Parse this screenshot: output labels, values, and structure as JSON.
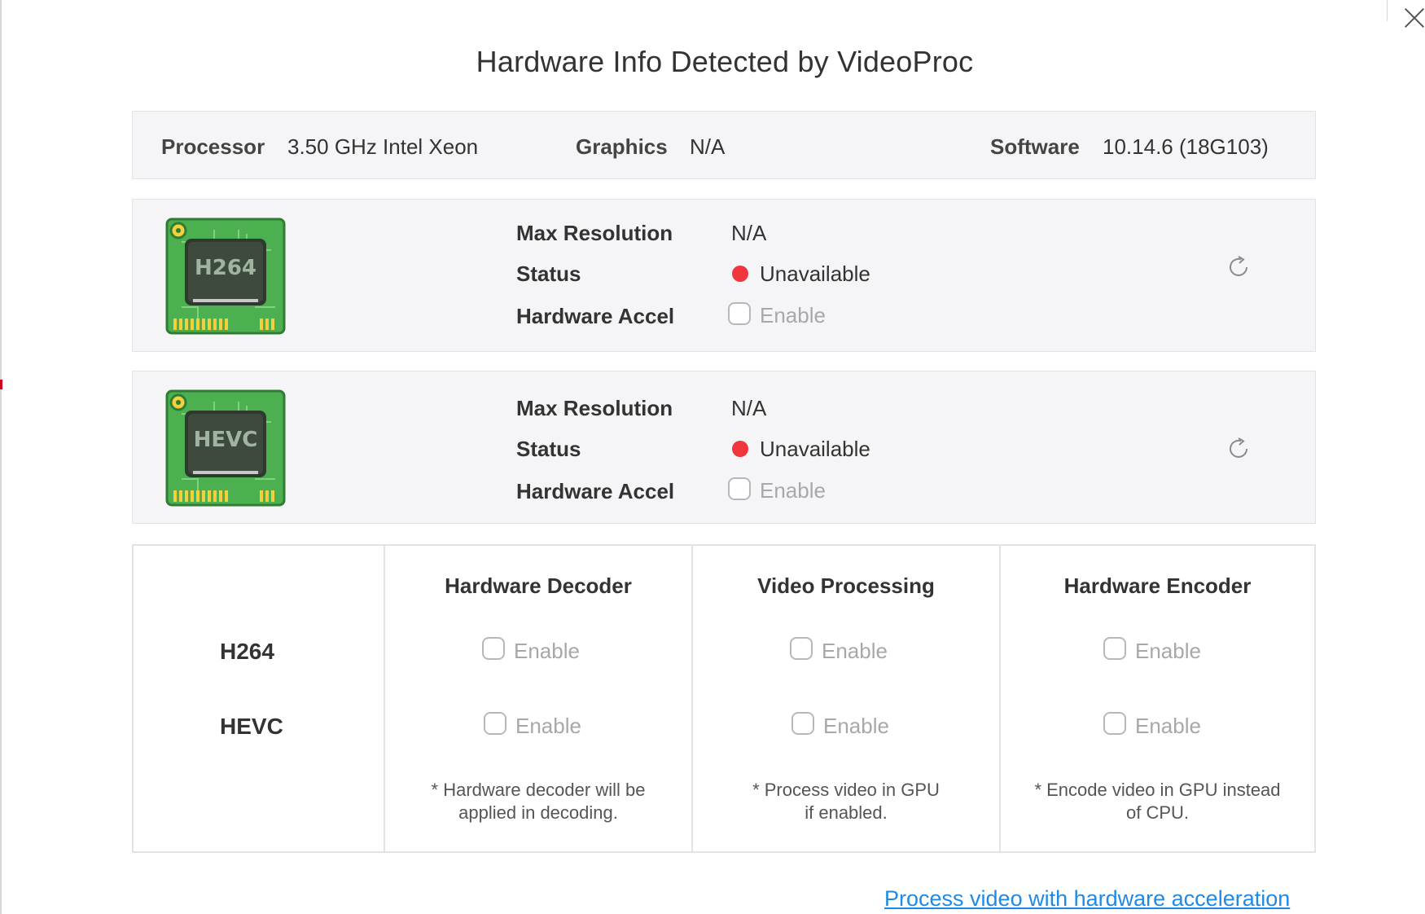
{
  "dialog": {
    "title": "Hardware Info Detected by VideoProc",
    "close_icon": "close-icon"
  },
  "system": {
    "processor_label": "Processor",
    "processor_value": "3.50 GHz Intel Xeon",
    "graphics_label": "Graphics",
    "graphics_value": "N/A",
    "software_label": "Software",
    "software_value": "10.14.6 (18G103)"
  },
  "codecs": [
    {
      "chip_label": "H264",
      "max_resolution_label": "Max Resolution",
      "max_resolution_value": "N/A",
      "status_label": "Status",
      "status_value": "Unavailable",
      "status_color": "#f0353d",
      "accel_label": "Hardware Accel",
      "accel_checkbox_label": "Enable",
      "refresh_icon": "refresh-icon"
    },
    {
      "chip_label": "HEVC",
      "max_resolution_label": "Max Resolution",
      "max_resolution_value": "N/A",
      "status_label": "Status",
      "status_value": "Unavailable",
      "status_color": "#f0353d",
      "accel_label": "Hardware Accel",
      "accel_checkbox_label": "Enable",
      "refresh_icon": "refresh-icon"
    }
  ],
  "matrix": {
    "columns": [
      "Hardware Decoder",
      "Video Processing",
      "Hardware Encoder"
    ],
    "rows": [
      "H264",
      "HEVC"
    ],
    "checkbox_label": "Enable",
    "notes": [
      [
        "* Hardware decoder will be",
        "applied in decoding."
      ],
      [
        "* Process video in GPU",
        "if enabled."
      ],
      [
        "* Encode video in GPU instead",
        "of CPU."
      ]
    ]
  },
  "footer": {
    "link_label": "Process video with hardware acceleration",
    "link_color": "#1e8ae6"
  }
}
